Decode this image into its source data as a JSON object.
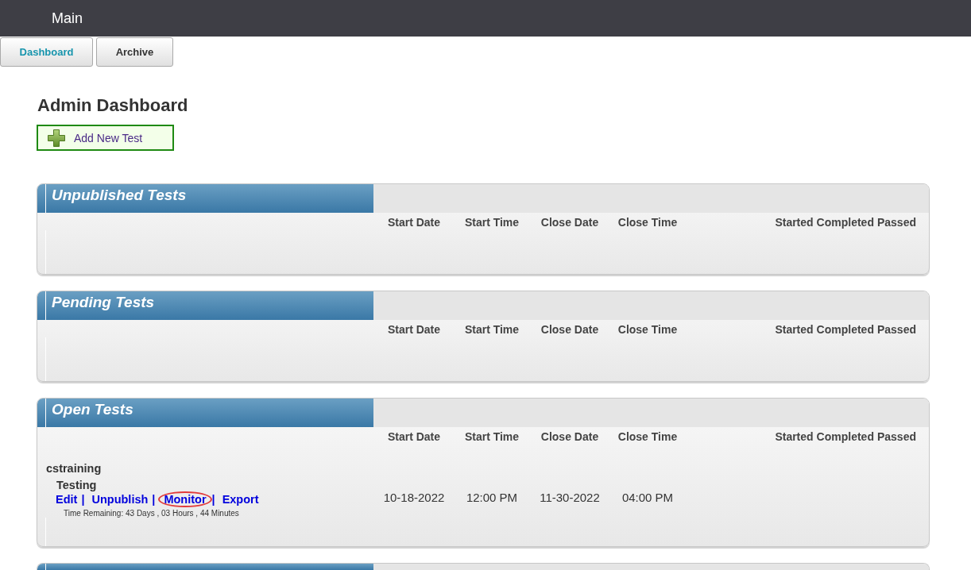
{
  "header": {
    "title": "Main"
  },
  "tabs": [
    {
      "label": "Dashboard",
      "selected": true
    },
    {
      "label": "Archive",
      "selected": false
    }
  ],
  "page_title": "Admin Dashboard",
  "add_button": {
    "label": "Add New Test"
  },
  "sections": [
    {
      "title": "Unpublished Tests",
      "columns": [
        "Start Date",
        "Start Time",
        "Close Date",
        "Close Time"
      ],
      "stat_columns": [
        "Started",
        "Completed",
        "Passed"
      ]
    },
    {
      "title": "Pending Tests",
      "columns": [
        "Start Date",
        "Start Time",
        "Close Date",
        "Close Time"
      ],
      "stat_columns": [
        "Started",
        "Completed",
        "Passed"
      ]
    },
    {
      "title": "Open Tests",
      "columns": [
        "Start Date",
        "Start Time",
        "Close Date",
        "Close Time"
      ],
      "stat_columns": [
        "Started",
        "Completed",
        "Passed"
      ],
      "groups": [
        {
          "name": "cstraining",
          "tests": [
            {
              "name": "Testing",
              "actions": [
                {
                  "label": "Edit",
                  "circled": false,
                  "separator": "|"
                },
                {
                  "label": "Unpublish",
                  "circled": false,
                  "separator": "|"
                },
                {
                  "label": "Monitor",
                  "circled": true,
                  "separator": "|"
                },
                {
                  "label": "Export",
                  "circled": false
                }
              ],
              "time_remaining": "Time Remaining: 43 Days , 03 Hours , 44 Minutes",
              "cells": [
                "10-18-2022",
                "12:00 PM",
                "11-30-2022",
                "04:00 PM"
              ]
            }
          ]
        }
      ]
    }
  ],
  "next_section_cut_off": true
}
